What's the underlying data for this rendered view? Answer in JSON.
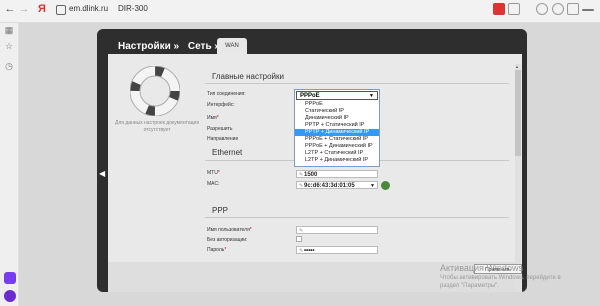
{
  "browser": {
    "back": "←",
    "forward": "→",
    "reload": "C",
    "yandex_logo": "Я",
    "url": "em.dlink.ru",
    "page_title": "DIR-300"
  },
  "breadcrumb": {
    "settings": "Настройки »",
    "network": "Сеть »"
  },
  "tab": {
    "label": "WAN"
  },
  "left_note": "Для данных настроек документация отсутствует",
  "main_settings": {
    "heading": "Главные настройки",
    "connection_type_label": "Тип соединения:",
    "interface_label": "Интерфейс:",
    "name_label": "Имя",
    "allow_label": "Разрешить",
    "direction_label": "Направление",
    "selected_value": "PPPoE",
    "options": [
      "PPPoE",
      "Статический IP",
      "Динамический IP",
      "PPTP + Статический IP",
      "PPTP + Динамический IP",
      "PPPoE + Статический IP",
      "PPPoE + Динамический IP",
      "L2TP + Статический IP",
      "L2TP + Динамический IP"
    ],
    "highlighted_index": 4
  },
  "ethernet": {
    "heading": "Ethernet",
    "mtu_label": "MTU",
    "mtu_value": "1500",
    "mac_label": "MAC:",
    "mac_value": "9c:d6:43:3d:01:05"
  },
  "ppp": {
    "heading": "PPP",
    "username_label": "Имя пользователя",
    "noauth_label": "Без авторизации:",
    "password_label": "Пароль",
    "password_value": "•••••"
  },
  "apply_button": "Применить",
  "activation": {
    "line1": "Активация Windows",
    "line2": "Чтобы активировать Windows, перейдите в",
    "line3": "раздел \"Параметры\"."
  },
  "icons": {
    "lifebuoy": "lifebuoy-icon",
    "globe": "globe-icon",
    "required_mark": "*"
  },
  "colors": {
    "frame": "#2e2e2e",
    "highlight": "#3399ff",
    "required": "#cc0000"
  }
}
